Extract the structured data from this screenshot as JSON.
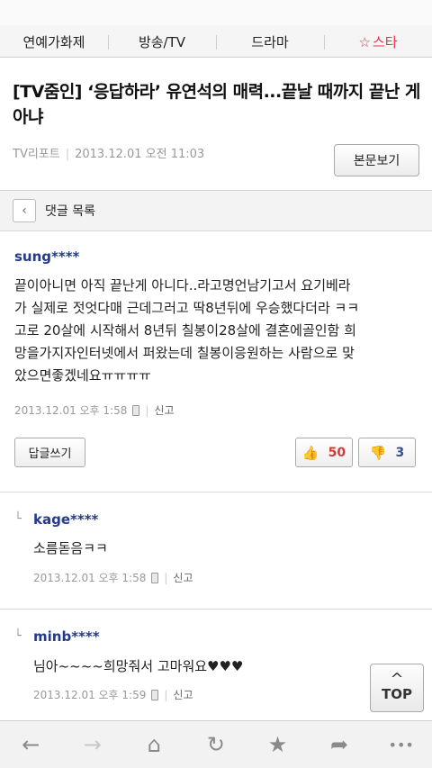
{
  "nav": {
    "tabs": [
      "연예가화제",
      "방송/TV",
      "드라마",
      "스타"
    ],
    "star_glyph": "☆"
  },
  "article": {
    "title": "[TV줌인] ‘응답하라’ 유연석의 매력...끝날 때까지 끝난 게 아냐",
    "source": "TV리포트",
    "date": "2013.12.01 오전 11:03",
    "view_button": "본문보기"
  },
  "comments_bar": {
    "back_icon": "chevron-left-icon",
    "title": "댓글 목록"
  },
  "main_comment": {
    "user": "sung****",
    "text_lines": [
      "끝이아니면 아직 끝난게 아니다..라고명언남기고서 요기베라",
      "가 실제로 젓엇다매 근데그러고 딱8년뒤에 우승했다더라 ㅋㅋ",
      "고로 20살에 시작해서 8년뒤 칠봉이28살에 결혼에골인함 희",
      "망을가지자인터넷에서 퍼왔는데 칠봉이응원하는 사람으로 맞",
      "았으면좋겠네요ㅠㅠㅠㅠ"
    ],
    "date": "2013.12.01 오후 1:58",
    "report": "신고",
    "reply_button": "답글쓰기",
    "likes": "50",
    "dislikes": "3"
  },
  "replies": [
    {
      "arrow": "└",
      "user": "kage****",
      "text": "소름돋음ㅋㅋ",
      "date": "2013.12.01 오후 1:58",
      "report": "신고"
    },
    {
      "arrow": "└",
      "user": "minb****",
      "text": "님아~~~~희망줘서 고마워요♥♥♥",
      "date": "2013.12.01 오후 1:59",
      "report": "신고"
    }
  ],
  "top_button": {
    "caret": "^",
    "label": "TOP"
  },
  "toolbar": {
    "icons": [
      "back-arrow-icon",
      "forward-arrow-icon",
      "home-icon",
      "refresh-icon",
      "bookmark-star-icon",
      "share-icon",
      "more-icon"
    ],
    "glyphs": [
      "←",
      "→",
      "⌂",
      "↻",
      "★",
      "➦",
      "•••"
    ]
  },
  "colors": {
    "username": "#243a8a",
    "accent_red": "#e8324a",
    "like_red": "#d23b3b"
  }
}
